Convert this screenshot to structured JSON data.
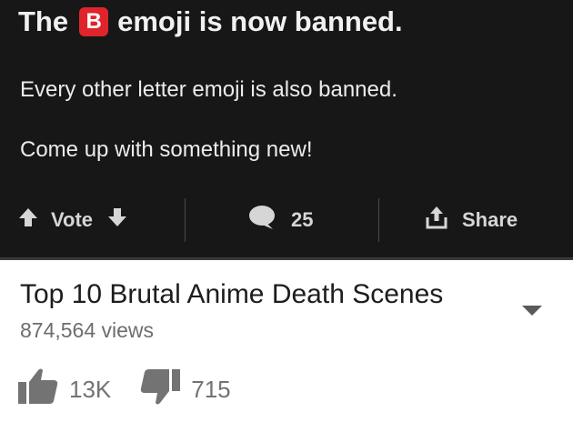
{
  "post": {
    "title_prefix": "The",
    "title_emoji_letter": "B",
    "title_suffix": "emoji is now banned.",
    "body_lines": [
      "Every other letter emoji is also banned.",
      "Come up with something new!"
    ],
    "actions": {
      "vote_label": "Vote",
      "comment_count": "25",
      "share_label": "Share"
    }
  },
  "video": {
    "title": "Top 10 Brutal Anime Death Scenes",
    "views": "874,564 views",
    "likes": "13K",
    "dislikes": "715"
  },
  "colors": {
    "dark_background": "#171717",
    "emoji_red": "#e0242b",
    "action_gray": "#d6d6d6",
    "meta_gray": "#737373"
  },
  "icons": [
    "arrow-up-icon",
    "arrow-down-icon",
    "comment-bubble-icon",
    "share-icon",
    "chevron-down-icon",
    "thumbs-up-icon",
    "thumbs-down-icon"
  ]
}
